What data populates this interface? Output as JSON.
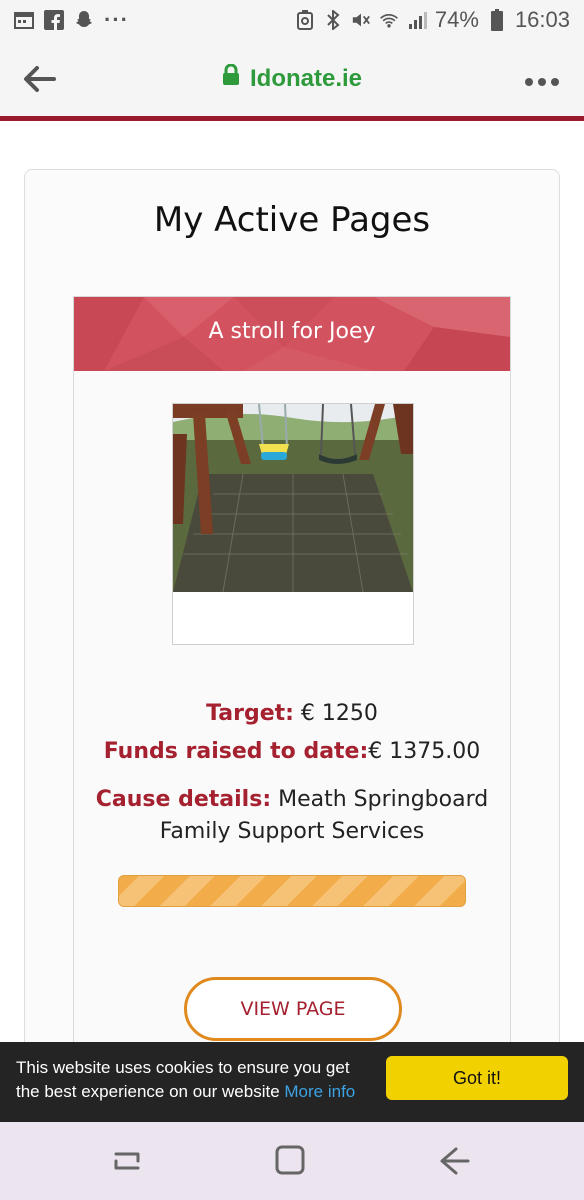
{
  "status_bar": {
    "battery": "74%",
    "time": "16:03",
    "more": "···"
  },
  "browser": {
    "url": "Idonate.ie"
  },
  "page": {
    "title": "My Active Pages",
    "card": {
      "title": "A stroll for Joey",
      "target_label": "Target:",
      "target_value": " € 1250",
      "funds_label": "Funds raised to date:",
      "funds_value": "€ 1375.00",
      "cause_label": "Cause details:",
      "cause_value_line1": " Meath Springboard",
      "cause_value_line2": "Family Support Services",
      "progress_fraction": 1.0,
      "button": "VIEW PAGE"
    }
  },
  "cookie": {
    "text": "This website uses cookies to ensure you get the best experience on our website ",
    "link": "More info",
    "accept": "Got it!"
  },
  "colors": {
    "accent_red": "#a5212f",
    "header_pink": "#d2525f",
    "progress_orange": "#f2ac4a",
    "link_green": "#2e9a3b",
    "cookie_button": "#f2d100"
  }
}
